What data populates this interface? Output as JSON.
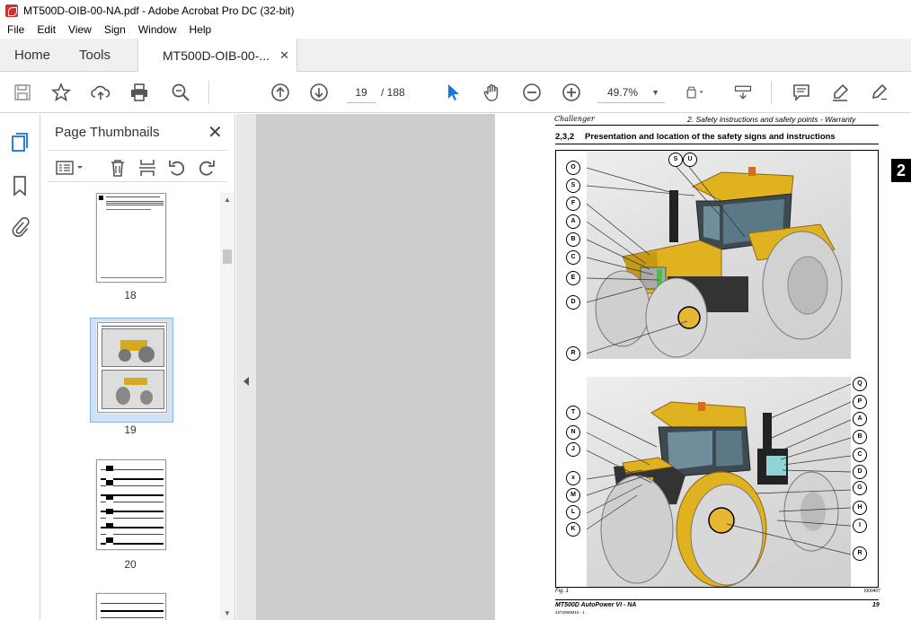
{
  "window": {
    "title": "MT500D-OIB-00-NA.pdf - Adobe Acrobat Pro DC (32-bit)"
  },
  "menu": [
    "File",
    "Edit",
    "View",
    "Sign",
    "Window",
    "Help"
  ],
  "tabs": {
    "home": "Home",
    "tools": "Tools",
    "document": "MT500D-OIB-00-...",
    "close": "✕"
  },
  "toolbar": {
    "current_page": "19",
    "total_pages": "/ 188",
    "zoom": "49.7%",
    "icons": [
      "save-icon",
      "bookmark-star-icon",
      "upload-icon",
      "print-icon",
      "zoom-search-icon",
      "page-up-icon",
      "page-down-icon",
      "select-arrow-icon",
      "hand-icon",
      "zoom-out-icon",
      "zoom-in-icon",
      "fit-page-icon",
      "scroll-mode-icon",
      "comment-icon",
      "highlight-icon",
      "sign-icon"
    ]
  },
  "thumbnails_panel": {
    "title": "Page Thumbnails",
    "close": "✕",
    "pages": [
      {
        "label": "18"
      },
      {
        "label": "19",
        "selected": true
      },
      {
        "label": "20"
      }
    ]
  },
  "page": {
    "header_logo": "Challenger",
    "header_right": "2. Safety instructions and safety points - Warranty",
    "section_number": "2,3,2",
    "section_title": "Presentation and location of the safety signs and instructions",
    "side_tab": "2",
    "fig_label": "Fig. 1",
    "fig_code": "I000407",
    "footer_left": "MT500D AutoPower VI - NA",
    "footer_sub": "4372060M10 - 1",
    "footer_page": "19",
    "top_callouts_left": [
      "O",
      "S",
      "F",
      "A",
      "B",
      "C",
      "E",
      "D",
      "R"
    ],
    "top_callouts_top": [
      "S",
      "U"
    ],
    "bottom_callouts_left": [
      "T",
      "N",
      "J",
      "x",
      "M",
      "L",
      "K"
    ],
    "bottom_callouts_right": [
      "Q",
      "P",
      "A",
      "B",
      "C",
      "D",
      "G",
      "H",
      "I",
      "R"
    ]
  },
  "colors": {
    "accent": "#1473e6",
    "tractor_yellow": "#e0b21f",
    "pdf_red": "#d0312d"
  }
}
